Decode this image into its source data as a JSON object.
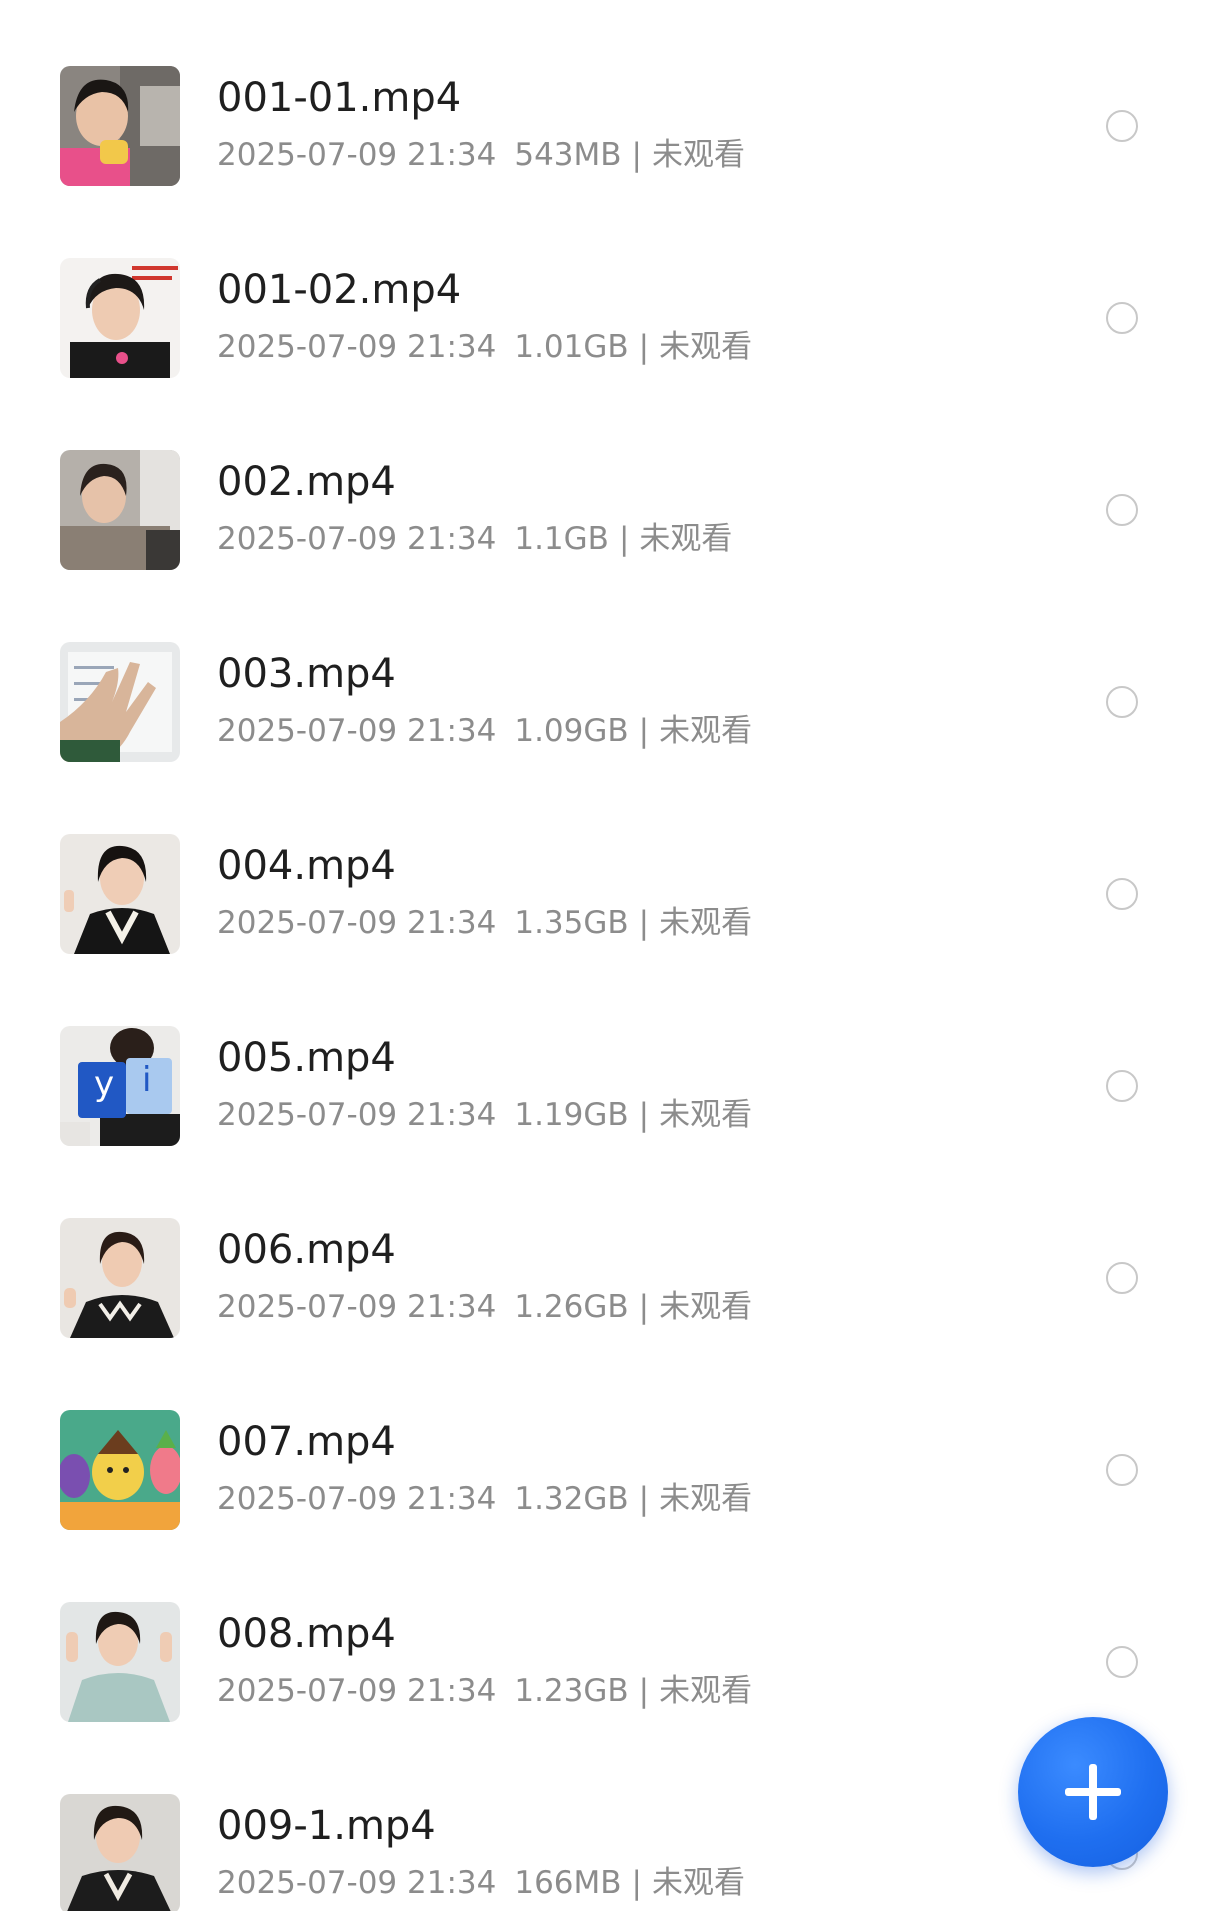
{
  "files": [
    {
      "name": "001-01.mp4",
      "date": "2025-07-09 21:34",
      "size": "543MB",
      "status": "未观看",
      "thumb": "woman-pink-toy",
      "selected": false
    },
    {
      "name": "001-02.mp4",
      "date": "2025-07-09 21:34",
      "size": "1.01GB",
      "status": "未观看",
      "thumb": "woman-headset-red-text",
      "selected": false
    },
    {
      "name": "002.mp4",
      "date": "2025-07-09 21:34",
      "size": "1.1GB",
      "status": "未观看",
      "thumb": "woman-headset-fur",
      "selected": false
    },
    {
      "name": "003.mp4",
      "date": "2025-07-09 21:34",
      "size": "1.09GB",
      "status": "未观看",
      "thumb": "hand-on-paper",
      "selected": false
    },
    {
      "name": "004.mp4",
      "date": "2025-07-09 21:34",
      "size": "1.35GB",
      "status": "未观看",
      "thumb": "woman-headset-black",
      "selected": false
    },
    {
      "name": "005.mp4",
      "date": "2025-07-09 21:34",
      "size": "1.19GB",
      "status": "未观看",
      "thumb": "letter-cards-y-i",
      "selected": false
    },
    {
      "name": "006.mp4",
      "date": "2025-07-09 21:34",
      "size": "1.26GB",
      "status": "未观看",
      "thumb": "woman-pattern-shirt",
      "selected": false
    },
    {
      "name": "007.mp4",
      "date": "2025-07-09 21:34",
      "size": "1.32GB",
      "status": "未观看",
      "thumb": "cartoon-characters",
      "selected": false
    },
    {
      "name": "008.mp4",
      "date": "2025-07-09 21:34",
      "size": "1.23GB",
      "status": "未观看",
      "thumb": "woman-green-hoodie",
      "selected": false
    },
    {
      "name": "009-1.mp4",
      "date": "2025-07-09 21:34",
      "size": "166MB",
      "status": "未观看",
      "thumb": "woman-headset-dark",
      "selected": false
    }
  ],
  "fab": {
    "icon": "plus-icon"
  },
  "colors": {
    "accent": "#1f6ff0",
    "title": "#1f1f1f",
    "meta": "#8c8c8c",
    "radio": "#c8c8c8"
  }
}
